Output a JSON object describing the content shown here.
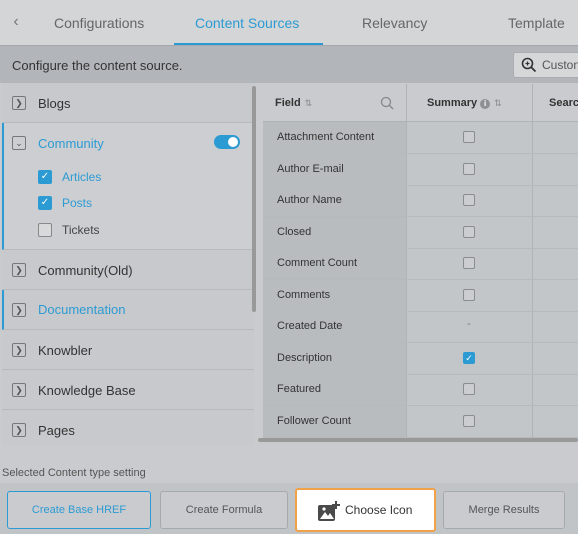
{
  "tabs": {
    "back_icon": "chevron-left-icon",
    "items": [
      {
        "label": "Configurations"
      },
      {
        "label": "Content Sources"
      },
      {
        "label": "Relevancy"
      },
      {
        "label": "Template"
      }
    ],
    "active_index": 1
  },
  "config_bar": {
    "text": "Configure the content source.",
    "custom_button_label": "Custon"
  },
  "sources": {
    "items": [
      {
        "label": "Blogs"
      },
      {
        "label": "Community",
        "expanded": true,
        "enabled": true,
        "children": [
          {
            "label": "Articles",
            "checked": true
          },
          {
            "label": "Posts",
            "checked": true
          },
          {
            "label": "Tickets",
            "checked": false
          }
        ]
      },
      {
        "label": "Community(Old)"
      },
      {
        "label": "Documentation"
      },
      {
        "label": "Knowbler"
      },
      {
        "label": "Knowledge Base"
      },
      {
        "label": "Pages"
      }
    ]
  },
  "table": {
    "headers": {
      "field": "Field",
      "summary": "Summary",
      "search": "Searc"
    },
    "rows": [
      {
        "field": "Attachment Content",
        "summary": "unchecked"
      },
      {
        "field": "Author E-mail",
        "summary": "unchecked"
      },
      {
        "field": "Author Name",
        "summary": "unchecked"
      },
      {
        "field": "Closed",
        "summary": "unchecked"
      },
      {
        "field": "Comment Count",
        "summary": "unchecked"
      },
      {
        "field": "Comments",
        "summary": "unchecked"
      },
      {
        "field": "Created Date",
        "summary": "-"
      },
      {
        "field": "Description",
        "summary": "checked"
      },
      {
        "field": "Featured",
        "summary": "unchecked"
      },
      {
        "field": "Follower Count",
        "summary": "unchecked"
      }
    ]
  },
  "bottom": {
    "section_label": "Selected Content type setting",
    "buttons": {
      "create_base_href": "Create Base HREF",
      "create_formula": "Create Formula",
      "choose_icon": "Choose Icon",
      "merge_results": "Merge Results"
    }
  },
  "colors": {
    "accent": "#2d9bd3",
    "highlight": "#f0a24a"
  }
}
